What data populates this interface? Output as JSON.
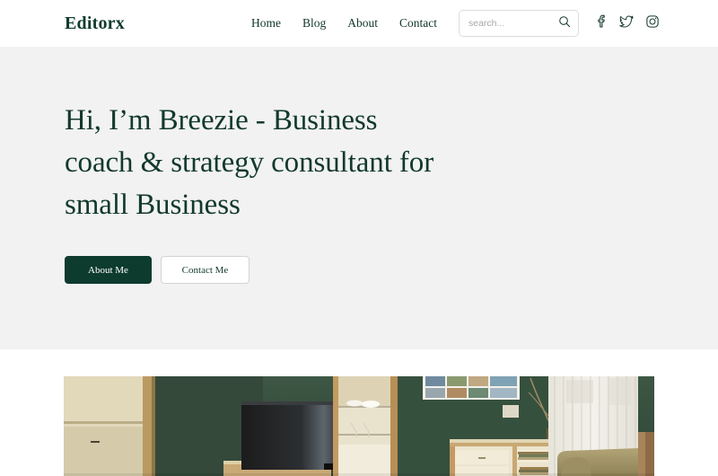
{
  "site": {
    "logo": "Editorx",
    "brand_color": "#0f3b2e",
    "hero_bg": "#f2f2f2",
    "page_bg": "#ffffff"
  },
  "header": {
    "nav": [
      {
        "label": "Home",
        "name": "nav-home"
      },
      {
        "label": "Blog",
        "name": "nav-blog"
      },
      {
        "label": "About",
        "name": "nav-about"
      },
      {
        "label": "Contact",
        "name": "nav-contact"
      }
    ],
    "search": {
      "value": "",
      "placeholder": "search...",
      "icon": "search-icon"
    },
    "socials": [
      {
        "name": "facebook-icon",
        "label": "Facebook"
      },
      {
        "name": "twitter-icon",
        "label": "Twitter"
      },
      {
        "name": "instagram-icon",
        "label": "Instagram"
      }
    ]
  },
  "hero": {
    "title": "Hi, I’m Breezie - Business coach & strategy consultant for small Business",
    "primary_button": "About Me",
    "secondary_button": "Contact Me",
    "primary_button_color": "#0d3b2e",
    "secondary_button_border": "#d3d3d3"
  },
  "photo": {
    "alt": "Interior of a living room with dark green wall, light wood cabinetry, a black television, glass display shelves, a sideboard with books, a vase of branches, framed photos, sheer curtains and an olive armchair",
    "colors": {
      "wall_green": "#39503f",
      "wood_light": "#c8a36a",
      "cabinet_cream": "#e8dfc4",
      "curtain": "#efece4",
      "armchair": "#a39569",
      "tv_black": "#161616"
    }
  }
}
